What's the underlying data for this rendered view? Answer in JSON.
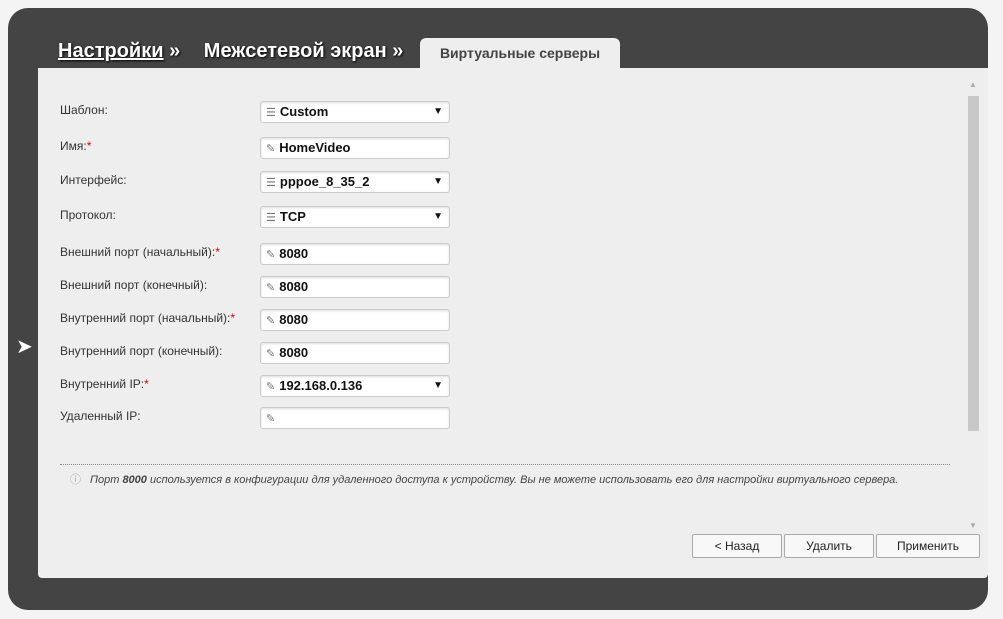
{
  "breadcrumb": {
    "item1": "Настройки",
    "item2": "Межсетевой экран",
    "sep": "»",
    "active_tab": "Виртуальные серверы"
  },
  "form": [
    {
      "label": "Шаблон:",
      "required": false,
      "value": "Custom",
      "type": "select"
    },
    {
      "label": "Имя:",
      "required": true,
      "value": "HomeVideo",
      "type": "text"
    },
    {
      "label": "Интерфейс:",
      "required": false,
      "value": "pppoe_8_35_2",
      "type": "select"
    },
    {
      "label": "Протокол:",
      "required": false,
      "value": "TCP",
      "type": "select"
    },
    {
      "label": "Внешний порт (начальный):",
      "required": true,
      "value": "8080",
      "type": "text"
    },
    {
      "label": "Внешний порт (конечный):",
      "required": false,
      "value": "8080",
      "type": "text"
    },
    {
      "label": "Внутренний порт (начальный):",
      "required": true,
      "value": "8080",
      "type": "text"
    },
    {
      "label": "Внутренний порт (конечный):",
      "required": false,
      "value": "8080",
      "type": "text"
    },
    {
      "label": "Внутренний IP:",
      "required": true,
      "value": "192.168.0.136",
      "type": "combo"
    },
    {
      "label": "Удаленный IP:",
      "required": false,
      "value": "",
      "type": "text"
    }
  ],
  "note": {
    "prefix": "Порт ",
    "port": "8000",
    "text": " используется в конфигурации для удаленного доступа к устройству. Вы не можете использовать его для настройки виртуального сервера."
  },
  "buttons": {
    "back": "< Назад",
    "delete": "Удалить",
    "apply": "Применить"
  }
}
